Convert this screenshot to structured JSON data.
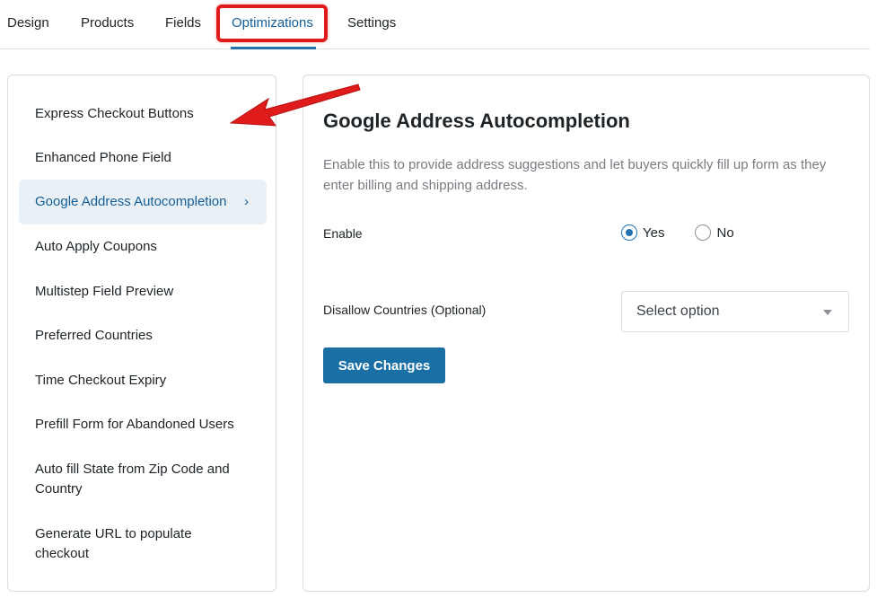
{
  "tabs": [
    {
      "label": "Design"
    },
    {
      "label": "Products"
    },
    {
      "label": "Fields"
    },
    {
      "label": "Optimizations",
      "active": true
    },
    {
      "label": "Settings"
    }
  ],
  "sidebar": {
    "items": [
      {
        "label": "Express Checkout Buttons"
      },
      {
        "label": "Enhanced Phone Field"
      },
      {
        "label": "Google Address Autocompletion",
        "active": true
      },
      {
        "label": "Auto Apply Coupons"
      },
      {
        "label": "Multistep Field Preview"
      },
      {
        "label": "Preferred Countries"
      },
      {
        "label": "Time Checkout Expiry"
      },
      {
        "label": "Prefill Form for Abandoned Users"
      },
      {
        "label": "Auto fill State from Zip Code and Country"
      },
      {
        "label": "Generate URL to populate checkout"
      }
    ],
    "active_chevron": "›"
  },
  "panel": {
    "title": "Google Address Autocompletion",
    "description": "Enable this to provide address suggestions and let buyers quickly fill up form as they enter billing and shipping address.",
    "enable_label": "Enable",
    "enable_options": [
      {
        "label": "Yes",
        "checked": true
      },
      {
        "label": "No",
        "checked": false
      }
    ],
    "disallow_label": "Disallow Countries (Optional)",
    "disallow_select": "Select option",
    "save_label": "Save Changes"
  },
  "colors": {
    "accent": "#2271b1",
    "button": "#1a6fa5",
    "highlight": "#e01b1b",
    "active_bg": "#e9f1f6"
  }
}
